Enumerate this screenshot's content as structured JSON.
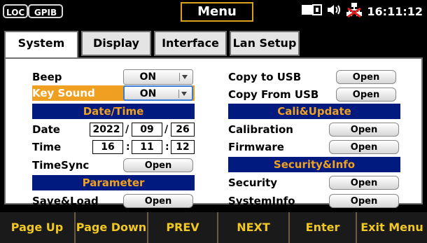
{
  "status": {
    "loc": "LOC",
    "gpib": "GPIB",
    "menu_title": "Menu",
    "clock": "16:11:12"
  },
  "tabs": [
    {
      "label": "System",
      "active": true
    },
    {
      "label": "Display",
      "active": false
    },
    {
      "label": "Interface",
      "active": false
    },
    {
      "label": "Lan Setup",
      "active": false
    }
  ],
  "left": {
    "beep": {
      "label": "Beep",
      "value": "ON"
    },
    "key_sound": {
      "label": "Key Sound",
      "value": "ON"
    },
    "datetime_header": "Date/Time",
    "date": {
      "label": "Date",
      "year": "2022",
      "month": "09",
      "day": "26"
    },
    "time": {
      "label": "Time",
      "hour": "16",
      "minute": "11",
      "second": "12"
    },
    "timesync": {
      "label": "TimeSync",
      "button": "Open"
    },
    "parameter_header": "Parameter",
    "saveload": {
      "label": "Save&Load",
      "button": "Open"
    },
    "date_sep": "/",
    "time_sep": ":"
  },
  "right": {
    "copy_to_usb": {
      "label": "Copy to USB",
      "button": "Open"
    },
    "copy_from_usb": {
      "label": "Copy From USB",
      "button": "Open"
    },
    "cali_header": "Cali&Update",
    "calibration": {
      "label": "Calibration",
      "button": "Open"
    },
    "firmware": {
      "label": "Firmware",
      "button": "Open"
    },
    "security_header": "Security&Info",
    "security": {
      "label": "Security",
      "button": "Open"
    },
    "systeminfo": {
      "label": "SystemInfo",
      "button": "Open"
    }
  },
  "softkeys": [
    "Page Up",
    "Page Down",
    "PREV",
    "NEXT",
    "Enter",
    "Exit Menu"
  ]
}
